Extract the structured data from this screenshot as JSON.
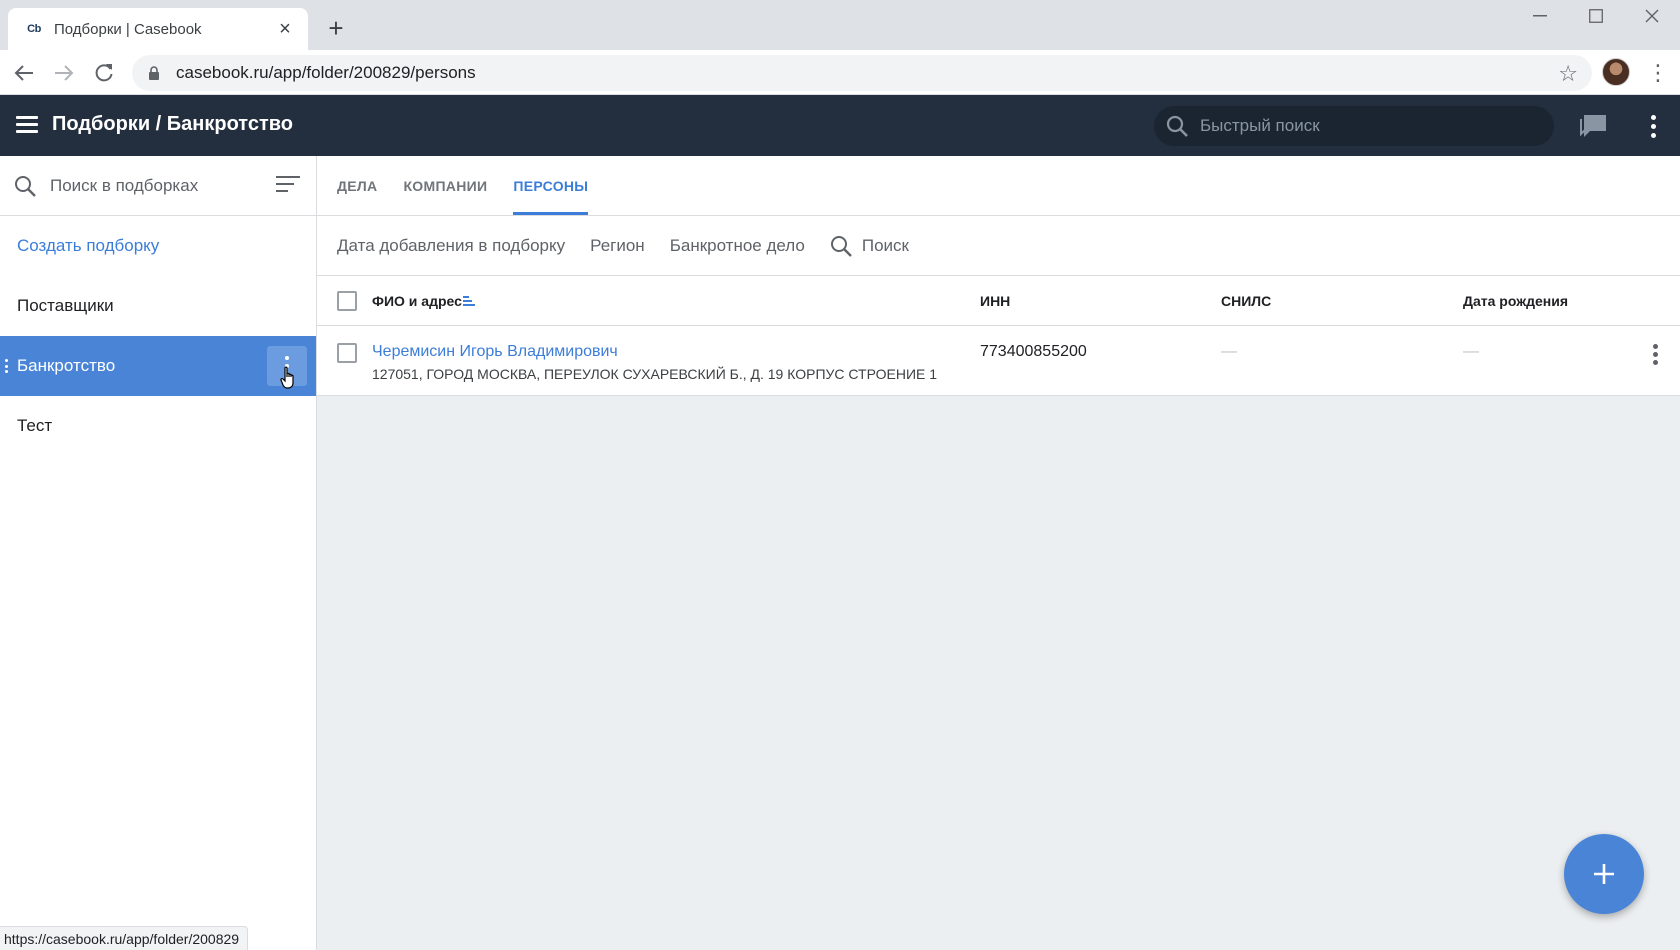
{
  "browser": {
    "tab_title": "Подборки | Casebook",
    "favicon_text": "Cb",
    "url": "casebook.ru/app/folder/200829/persons",
    "status_url": "https://casebook.ru/app/folder/200829"
  },
  "header": {
    "title": "Подборки / Банкротство",
    "search_placeholder": "Быстрый поиск"
  },
  "sidebar": {
    "search_placeholder": "Поиск в подборках",
    "create_label": "Создать подборку",
    "items": [
      {
        "label": "Поставщики",
        "active": false
      },
      {
        "label": "Банкротство",
        "active": true
      },
      {
        "label": "Тест",
        "active": false
      }
    ]
  },
  "main": {
    "tabs": [
      {
        "label": "ДЕЛА",
        "active": false
      },
      {
        "label": "КОМПАНИИ",
        "active": false
      },
      {
        "label": "ПЕРСОНЫ",
        "active": true
      }
    ],
    "filters": {
      "date_added": "Дата добавления в подборку",
      "region": "Регион",
      "bankruptcy_case": "Банкротное дело",
      "search": "Поиск"
    },
    "table": {
      "columns": {
        "name": "ФИО и адрес",
        "inn": "ИНН",
        "snils": "СНИЛС",
        "birth": "Дата рождения"
      },
      "rows": [
        {
          "name": "Черемисин Игорь Владимирович",
          "address": "127051, ГОРОД МОСКВА, ПЕРЕУЛОК СУХАРЕВСКИЙ Б., Д. 19 КОРПУС СТРОЕНИЕ 1",
          "inn": "773400855200",
          "snils": "—",
          "birth": "—"
        }
      ]
    }
  },
  "colors": {
    "appbar": "#232f3e",
    "accent": "#3b7dd8",
    "active_item": "#4a84d6",
    "main_bg": "#eceff1"
  }
}
